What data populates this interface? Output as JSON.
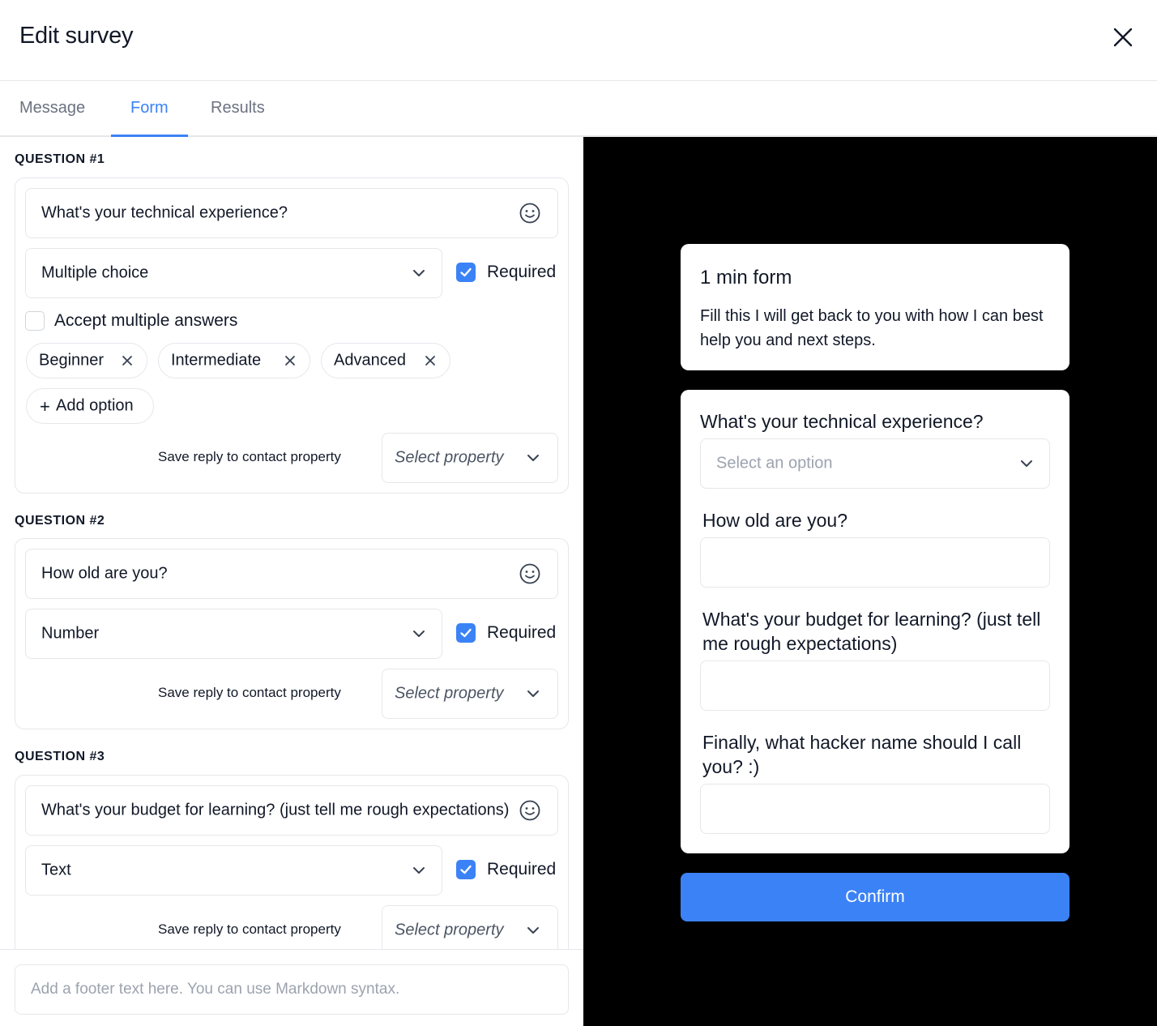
{
  "header": {
    "title": "Edit survey"
  },
  "tabs": [
    {
      "label": "Message",
      "active": false
    },
    {
      "label": "Form",
      "active": true
    },
    {
      "label": "Results",
      "active": false
    }
  ],
  "questions": [
    {
      "section_label": "QUESTION #1",
      "question_text": "What's your technical experience?",
      "type": "Multiple choice",
      "required_label": "Required",
      "required": true,
      "accept_multiple_label": "Accept multiple answers",
      "accept_multiple": false,
      "options": [
        "Beginner",
        "Intermediate",
        "Advanced"
      ],
      "add_option_label": "Add option",
      "save_reply_label": "Save reply to contact property",
      "property_placeholder": "Select property"
    },
    {
      "section_label": "QUESTION #2",
      "question_text": "How old are you?",
      "type": "Number",
      "required_label": "Required",
      "required": true,
      "save_reply_label": "Save reply to contact property",
      "property_placeholder": "Select property"
    },
    {
      "section_label": "QUESTION #3",
      "question_text": "What's your budget for learning? (just tell me rough expectations)",
      "type": "Text",
      "required_label": "Required",
      "required": true,
      "save_reply_label": "Save reply to contact property",
      "property_placeholder": "Select property"
    }
  ],
  "footer": {
    "placeholder": "Add a footer text here. You can use Markdown syntax."
  },
  "preview": {
    "form_title": "1 min form",
    "form_description": "Fill this I will get back to you with how I can best help you and next steps.",
    "q1": "What's your technical experience?",
    "q1_placeholder": "Select an option",
    "q2": "How old are you?",
    "q3": "What's your budget for learning? (just tell me rough expectations)",
    "q4": "Finally, what hacker name should I call you? :)",
    "confirm_label": "Confirm",
    "background_color": "#000000",
    "button_color": "#3b82f6"
  },
  "colors": {
    "accent": "#3b82f6",
    "border": "#e5e7eb"
  },
  "icons": {
    "close": "close-icon",
    "emoji": "smiley-icon",
    "dropdown": "chevron-down-icon",
    "check": "check-icon",
    "remove": "x-icon",
    "add": "plus-icon"
  }
}
